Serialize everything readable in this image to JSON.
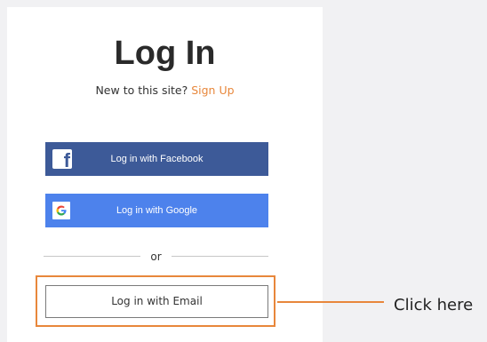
{
  "login": {
    "title": "Log In",
    "new_prompt": "New to this site?",
    "signup_link": "Sign Up",
    "facebook_label": "Log in with Facebook",
    "google_label": "Log in with Google",
    "or_text": "or",
    "email_label": "Log in with Email"
  },
  "annotation": {
    "callout_text": "Click here"
  },
  "colors": {
    "accent": "#e8873b",
    "facebook": "#3d5a98",
    "google": "#4d82ec"
  },
  "icons": {
    "facebook": "facebook-icon",
    "google": "google-icon"
  }
}
